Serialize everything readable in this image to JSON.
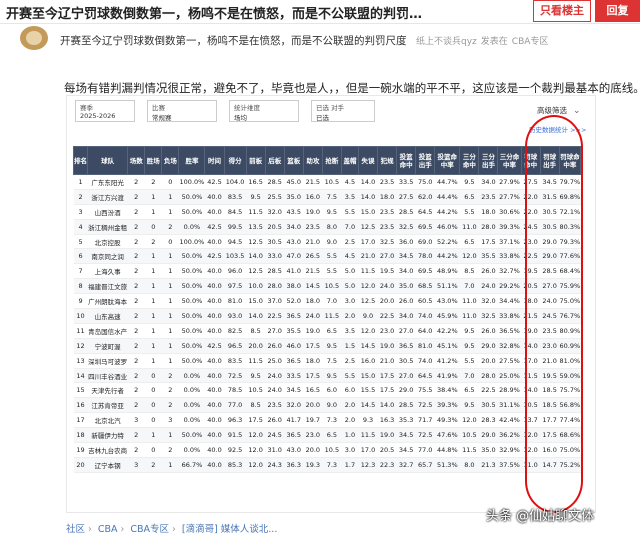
{
  "topbar": {
    "title": "开赛至今辽宁罚球数倒数第一，杨鸣不是在愤怒，而是不公联盟的判罚…",
    "op_only_label": "只看楼主",
    "reply_label": "回复"
  },
  "post": {
    "title": "开赛至今辽宁罚球数倒数第一，杨鸣不是在愤怒，而是不公联盟的判罚尺度",
    "author": "纸上不谈兵qyz",
    "published_in": "发表在",
    "board": "CBA专区",
    "description": "每场有错判漏判情况很正常，避免不了，毕竟也是人，，但是一碗水端的平不平，这应该是一个裁判最基本的底线。"
  },
  "screenshot": {
    "filters": [
      {
        "label": "赛季",
        "value": "2025-2026"
      },
      {
        "label": "比赛",
        "value": "常规赛"
      },
      {
        "label": "统计维度",
        "value": "场均"
      },
      {
        "label": "已选 对手",
        "value": "已选"
      }
    ],
    "advanced_filter": "高级筛选",
    "history_link": "历史数据统计 >>>",
    "headers": [
      "排名",
      "球队",
      "场数",
      "胜场",
      "负场",
      "胜率",
      "时间",
      "得分",
      "前板",
      "后板",
      "篮板",
      "助攻",
      "抢断",
      "盖帽",
      "失误",
      "犯规",
      "投篮命中",
      "投篮出手",
      "投篮命中率",
      "三分命中",
      "三分出手",
      "三分命中率",
      "罚球命中",
      "罚球出手",
      "罚球命中率"
    ],
    "rows": [
      [
        "1",
        "广东东阳光",
        "2",
        "2",
        "0",
        "100.0%",
        "42.5",
        "104.0",
        "16.5",
        "28.5",
        "45.0",
        "21.5",
        "10.5",
        "4.5",
        "14.0",
        "23.5",
        "33.5",
        "75.0",
        "44.7%",
        "9.5",
        "34.0",
        "27.9%",
        "27.5",
        "34.5",
        "79.7%"
      ],
      [
        "2",
        "浙江方兴渡",
        "2",
        "1",
        "1",
        "50.0%",
        "40.0",
        "83.5",
        "9.5",
        "25.5",
        "35.0",
        "16.0",
        "7.5",
        "3.5",
        "14.0",
        "18.0",
        "27.5",
        "62.0",
        "44.4%",
        "6.5",
        "23.5",
        "27.7%",
        "22.0",
        "31.5",
        "69.8%"
      ],
      [
        "3",
        "山西汾酒",
        "2",
        "1",
        "1",
        "50.0%",
        "40.0",
        "84.5",
        "11.5",
        "32.0",
        "43.5",
        "19.0",
        "9.5",
        "5.5",
        "15.0",
        "23.5",
        "28.5",
        "64.5",
        "44.2%",
        "5.5",
        "18.0",
        "30.6%",
        "22.0",
        "30.5",
        "72.1%"
      ],
      [
        "4",
        "浙江稠州金租",
        "2",
        "0",
        "2",
        "0.0%",
        "42.5",
        "99.5",
        "13.5",
        "20.5",
        "34.0",
        "23.5",
        "8.0",
        "7.0",
        "12.5",
        "23.5",
        "32.5",
        "69.5",
        "46.0%",
        "11.0",
        "28.0",
        "39.3%",
        "24.5",
        "30.5",
        "80.3%"
      ],
      [
        "5",
        "北京控股",
        "2",
        "2",
        "0",
        "100.0%",
        "40.0",
        "94.5",
        "12.5",
        "30.5",
        "43.0",
        "21.0",
        "9.0",
        "2.5",
        "17.0",
        "32.5",
        "36.0",
        "69.0",
        "52.2%",
        "6.5",
        "17.5",
        "37.1%",
        "23.0",
        "29.0",
        "79.3%"
      ],
      [
        "6",
        "南京同之润",
        "2",
        "1",
        "1",
        "50.0%",
        "42.5",
        "103.5",
        "14.0",
        "33.0",
        "47.0",
        "26.5",
        "5.5",
        "4.5",
        "21.0",
        "27.0",
        "34.5",
        "78.0",
        "44.2%",
        "12.0",
        "35.5",
        "33.8%",
        "22.5",
        "29.0",
        "77.6%"
      ],
      [
        "7",
        "上海久事",
        "2",
        "1",
        "1",
        "50.0%",
        "40.0",
        "96.0",
        "12.5",
        "28.5",
        "41.0",
        "21.5",
        "5.5",
        "5.0",
        "11.5",
        "19.5",
        "34.0",
        "69.5",
        "48.9%",
        "8.5",
        "26.0",
        "32.7%",
        "19.5",
        "28.5",
        "68.4%"
      ],
      [
        "8",
        "福建晋江文旅",
        "2",
        "1",
        "1",
        "50.0%",
        "40.0",
        "97.5",
        "10.0",
        "28.0",
        "38.0",
        "14.5",
        "10.5",
        "5.0",
        "12.0",
        "24.0",
        "35.0",
        "68.5",
        "51.1%",
        "7.0",
        "24.0",
        "29.2%",
        "20.5",
        "27.0",
        "75.9%"
      ],
      [
        "9",
        "广州朗肽海本",
        "2",
        "1",
        "1",
        "50.0%",
        "40.0",
        "81.0",
        "15.0",
        "37.0",
        "52.0",
        "18.0",
        "7.0",
        "3.0",
        "12.5",
        "20.0",
        "26.0",
        "60.5",
        "43.0%",
        "11.0",
        "32.0",
        "34.4%",
        "18.0",
        "24.0",
        "75.0%"
      ],
      [
        "10",
        "山东高速",
        "2",
        "1",
        "1",
        "50.0%",
        "40.0",
        "93.0",
        "14.0",
        "22.5",
        "36.5",
        "24.0",
        "11.5",
        "2.0",
        "9.0",
        "22.5",
        "34.0",
        "74.0",
        "45.9%",
        "11.0",
        "32.5",
        "33.8%",
        "21.5",
        "24.5",
        "76.7%"
      ],
      [
        "11",
        "青岛国信水产",
        "2",
        "1",
        "1",
        "50.0%",
        "40.0",
        "82.5",
        "8.5",
        "27.0",
        "35.5",
        "19.0",
        "6.5",
        "3.5",
        "12.0",
        "23.0",
        "27.0",
        "64.0",
        "42.2%",
        "9.5",
        "26.0",
        "36.5%",
        "19.0",
        "23.5",
        "80.9%"
      ],
      [
        "12",
        "宁波町渥",
        "2",
        "1",
        "1",
        "50.0%",
        "42.5",
        "96.5",
        "20.0",
        "26.0",
        "46.0",
        "17.5",
        "9.5",
        "1.5",
        "14.5",
        "19.0",
        "36.5",
        "81.0",
        "45.1%",
        "9.5",
        "29.0",
        "32.8%",
        "14.0",
        "23.0",
        "60.9%"
      ],
      [
        "13",
        "深圳马可波罗",
        "2",
        "1",
        "1",
        "50.0%",
        "40.0",
        "83.5",
        "11.5",
        "25.0",
        "36.5",
        "18.0",
        "7.5",
        "2.5",
        "16.0",
        "21.0",
        "30.5",
        "74.0",
        "41.2%",
        "5.5",
        "20.0",
        "27.5%",
        "17.0",
        "21.0",
        "81.0%"
      ],
      [
        "14",
        "四川丰谷酒业",
        "2",
        "0",
        "2",
        "0.0%",
        "40.0",
        "72.5",
        "9.5",
        "24.0",
        "33.5",
        "17.5",
        "9.5",
        "5.5",
        "15.0",
        "17.5",
        "27.0",
        "64.5",
        "41.9%",
        "7.0",
        "28.0",
        "25.0%",
        "11.5",
        "19.5",
        "59.0%"
      ],
      [
        "15",
        "天津先行者",
        "2",
        "0",
        "2",
        "0.0%",
        "40.0",
        "78.5",
        "10.5",
        "24.0",
        "34.5",
        "16.5",
        "6.0",
        "6.0",
        "15.5",
        "17.5",
        "29.0",
        "75.5",
        "38.4%",
        "6.5",
        "22.5",
        "28.9%",
        "14.0",
        "18.5",
        "75.7%"
      ],
      [
        "16",
        "江苏肯帝亚",
        "2",
        "0",
        "2",
        "0.0%",
        "40.0",
        "77.0",
        "8.5",
        "23.5",
        "32.0",
        "20.0",
        "9.0",
        "2.0",
        "14.5",
        "14.0",
        "28.5",
        "72.5",
        "39.3%",
        "9.5",
        "30.5",
        "31.1%",
        "10.5",
        "18.5",
        "56.8%"
      ],
      [
        "17",
        "北京北汽",
        "3",
        "0",
        "3",
        "0.0%",
        "40.0",
        "96.3",
        "17.5",
        "26.0",
        "41.7",
        "19.7",
        "7.3",
        "2.0",
        "9.3",
        "16.3",
        "35.3",
        "71.7",
        "49.3%",
        "12.0",
        "28.3",
        "42.4%",
        "13.7",
        "17.7",
        "77.4%"
      ],
      [
        "18",
        "新疆伊力特",
        "2",
        "1",
        "1",
        "50.0%",
        "40.0",
        "91.5",
        "12.0",
        "24.5",
        "36.5",
        "23.0",
        "6.5",
        "1.0",
        "11.5",
        "19.0",
        "34.5",
        "72.5",
        "47.6%",
        "10.5",
        "29.0",
        "36.2%",
        "12.0",
        "17.5",
        "68.6%"
      ],
      [
        "19",
        "吉林九台农商",
        "2",
        "0",
        "2",
        "0.0%",
        "40.0",
        "92.5",
        "12.0",
        "31.0",
        "43.0",
        "20.0",
        "10.5",
        "3.0",
        "17.0",
        "20.5",
        "34.5",
        "77.0",
        "44.8%",
        "11.5",
        "35.0",
        "32.9%",
        "12.0",
        "16.0",
        "75.0%"
      ],
      [
        "20",
        "辽宁本钢",
        "3",
        "2",
        "1",
        "66.7%",
        "40.0",
        "85.3",
        "12.0",
        "24.3",
        "36.3",
        "19.3",
        "7.3",
        "1.7",
        "12.3",
        "22.3",
        "32.7",
        "65.7",
        "51.3%",
        "8.0",
        "21.3",
        "37.5%",
        "11.0",
        "14.7",
        "75.2%"
      ]
    ]
  },
  "breadcrumb": [
    "社区",
    "CBA",
    "CBA专区",
    "[滴滴哥] 媒体人谈北..."
  ],
  "watermark": "头条 @仙姑聊文体",
  "colors": {
    "accent": "#dd3333",
    "table_header": "#3c4b63",
    "link": "#4a76b6",
    "annotation": "#e01010"
  }
}
